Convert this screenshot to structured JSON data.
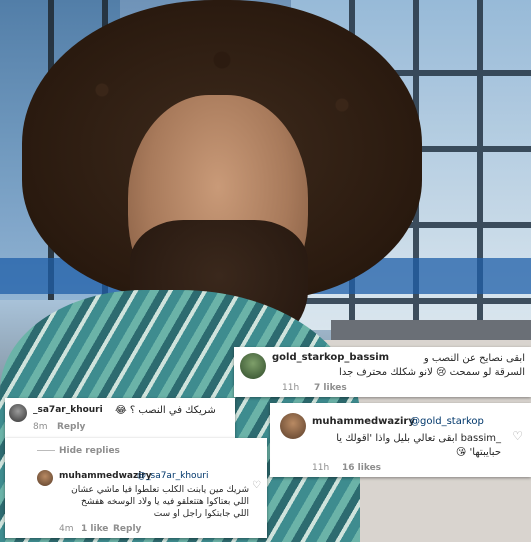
{
  "photo": {
    "description_icon": "portrait-photo"
  },
  "comment_a": {
    "username": "gold_starkop_bassim",
    "line1": "ابقى نصايح عن النصب و",
    "line2": "السرقة لو سمحت 😢 لانو شكلك محترف جدا",
    "time": "11h",
    "likes": "7 likes"
  },
  "comment_b": {
    "username": "muhammedwaziry",
    "mention": "@gold_starkop",
    "line1": "_bassim ابقى تعالي بليل واذا 'اقولك يا",
    "line2": "حبايبتها' 😘",
    "time": "11h",
    "likes": "16 likes"
  },
  "comment_c": {
    "username": "_sa7ar_khouri",
    "text": "شريكك في النصب ؟ 😂",
    "time": "8m",
    "reply": "Reply"
  },
  "comment_d": {
    "hide_replies": "Hide replies",
    "username": "muhammedwaziry",
    "mention": "@_sa7ar_khouri",
    "line1": "شريك مين يابنت الكلب تعلطوا فيا ماشي عشان",
    "line2": "اللي بعتاكوا هتتعلقو فيه يا ولاد الوسخه هفشخ",
    "line3": "اللي جابتكوا راجل او ست",
    "time": "4m",
    "likes": "1 like",
    "reply": "Reply"
  }
}
